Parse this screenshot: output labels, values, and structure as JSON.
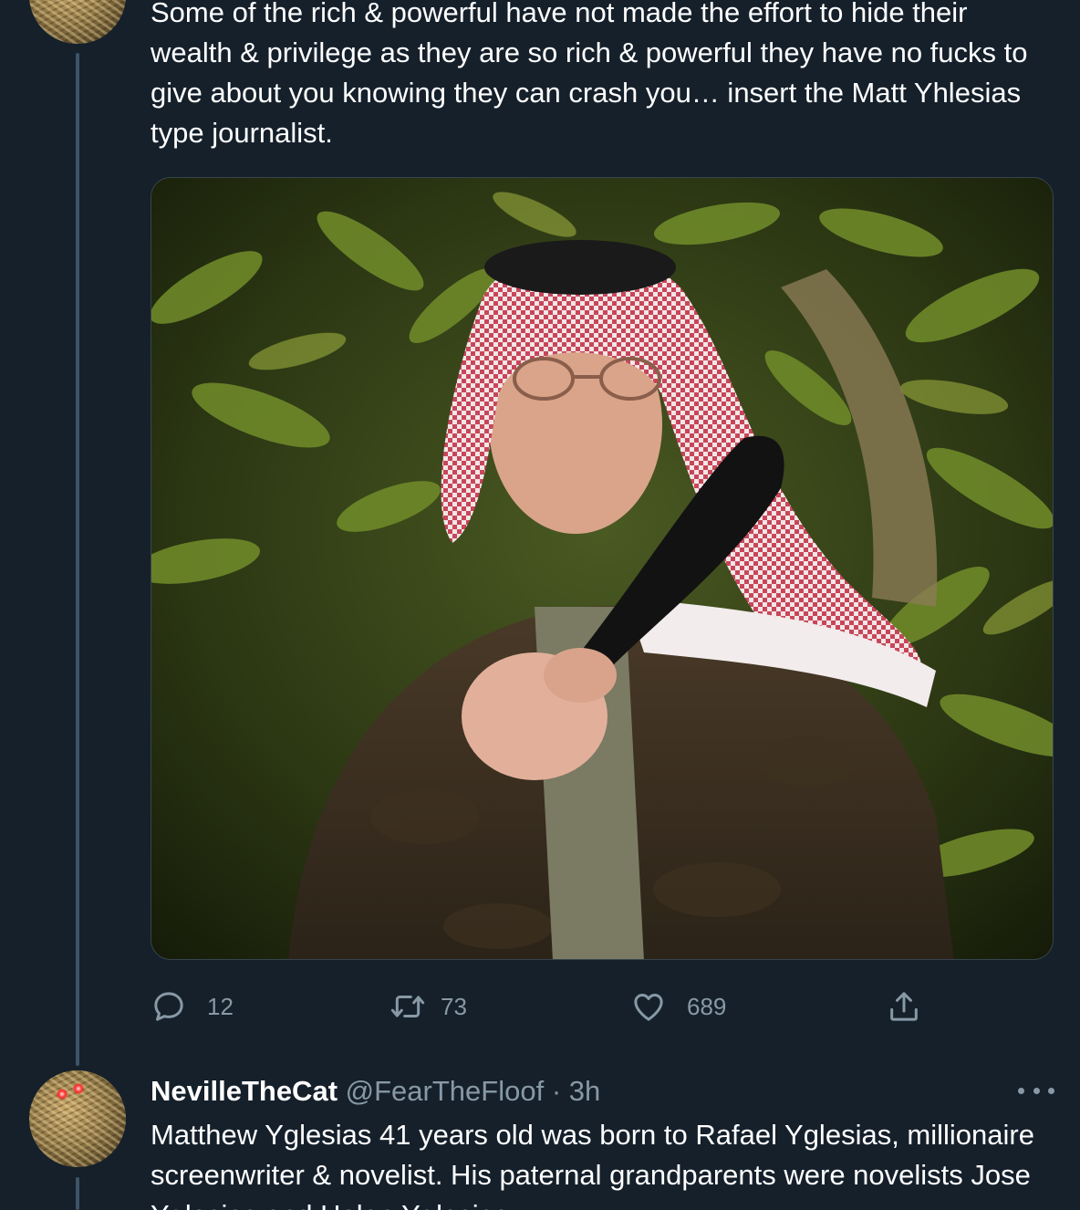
{
  "tweet1": {
    "text": "Some of the rich & powerful have not made the effort to hide their wealth & privilege as they are so rich & powerful they have no fucks to give about you knowing they can crash you… insert the Matt Yhlesias type journalist.",
    "actions": {
      "replies": "12",
      "retweets": "73",
      "likes": "689"
    }
  },
  "tweet2": {
    "name": "NevilleTheCat",
    "handle": "@FearTheFloof",
    "separator": "·",
    "time": "3h",
    "text": "Matthew Yglesias 41 years old was born to Rafael Yglesias, millionaire screenwriter & novelist. His paternal grandparents were novelists Jose Yglesias and Helen Yglesias."
  },
  "icons": {
    "reply": "reply-icon",
    "retweet": "retweet-icon",
    "like": "heart-icon",
    "share": "share-icon",
    "more": "more-icon"
  },
  "colors": {
    "background": "#15202b",
    "text": "#ffffff",
    "secondary_text": "#8899a6",
    "thread_line": "#3d5466",
    "border": "#38444d"
  }
}
